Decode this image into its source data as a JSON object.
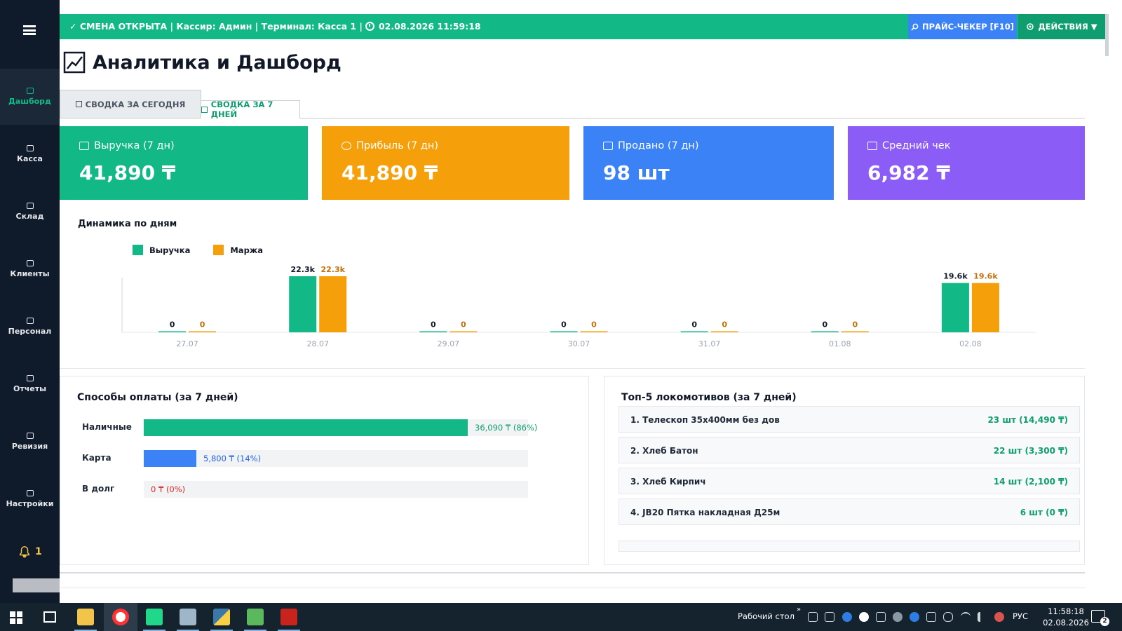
{
  "sidebar": {
    "items": [
      {
        "label": "Дашборд",
        "active": true
      },
      {
        "label": "Касса"
      },
      {
        "label": "Склад"
      },
      {
        "label": "Клиенты"
      },
      {
        "label": "Персонал"
      },
      {
        "label": "Отчеты"
      },
      {
        "label": "Ревизия"
      },
      {
        "label": "Настройки"
      }
    ],
    "notifications": "1"
  },
  "topbar": {
    "status": "✓ СМЕНА ОТКРЫТА | Кассир: Админ | Терминал: Касса 1 |",
    "datetime": "02.08.2026 11:59:18",
    "price_checker": "ПРАЙС-ЧЕКЕР [F10]",
    "actions": "ДЕЙСТВИЯ ▼"
  },
  "page": {
    "title": "Аналитика и Дашборд"
  },
  "tabs": {
    "today": "СВОДКА ЗА СЕГОДНЯ",
    "week": "СВОДКА ЗА 7 ДНЕЙ"
  },
  "kpis": [
    {
      "label": "Выручка (7 дн)",
      "value": "41,890 ₸",
      "color": "#12b886"
    },
    {
      "label": "Прибыль (7 дн)",
      "value": "41,890 ₸",
      "color": "#f59f0a"
    },
    {
      "label": "Продано (7 дн)",
      "value": "98 шт",
      "color": "#3b82f6"
    },
    {
      "label": "Средний чек",
      "value": "6,982 ₸",
      "color": "#8b5cf6"
    }
  ],
  "chart_data": {
    "type": "bar",
    "title": "Динамика по дням",
    "categories": [
      "27.07",
      "28.07",
      "29.07",
      "30.07",
      "31.07",
      "01.08",
      "02.08"
    ],
    "series": [
      {
        "name": "Выручка",
        "color": "#12b886",
        "values": [
          0,
          22300,
          0,
          0,
          0,
          0,
          19600
        ],
        "labels": [
          "0",
          "22.3k",
          "0",
          "0",
          "0",
          "0",
          "19.6k"
        ]
      },
      {
        "name": "Маржа",
        "color": "#f59f0a",
        "values": [
          0,
          22300,
          0,
          0,
          0,
          0,
          19600
        ],
        "labels": [
          "0",
          "22.3k",
          "0",
          "0",
          "0",
          "0",
          "19.6k"
        ]
      }
    ],
    "legend_position": "top-left",
    "grid": false
  },
  "payments": {
    "title": "Способы оплаты (за 7 дней)",
    "rows": [
      {
        "label": "Наличные",
        "value": "36,090 ₸ (86%)",
        "fraction": 0.86,
        "color": "#12b886",
        "text_color": "#0f9d6f"
      },
      {
        "label": "Карта",
        "value": "5,800 ₸ (14%)",
        "fraction": 0.14,
        "color": "#3b82f6",
        "text_color": "#2563eb"
      },
      {
        "label": "В долг",
        "value": "0 ₸ (0%)",
        "fraction": 0,
        "color": "#ef4444",
        "text_color": "#dc2626"
      }
    ]
  },
  "top5": {
    "title": "Топ-5 локомотивов (за 7 дней)",
    "items": [
      {
        "name": "1. Телескоп 35х400мм без дов",
        "value": "23 шт (14,490 ₸)"
      },
      {
        "name": "2. Хлеб Батон",
        "value": "22 шт (3,300 ₸)"
      },
      {
        "name": "3. Хлеб Кирпич",
        "value": "14 шт (2,100 ₸)"
      },
      {
        "name": "4. JB20 Пятка накладная Д25м",
        "value": "6 шт (0 ₸)"
      }
    ]
  },
  "taskbar": {
    "desktop_label": "Рабочий стол",
    "chevron": "»",
    "lang": "РУС",
    "time": "11:58:18",
    "date": "02.08.2026",
    "notifications": "2"
  }
}
